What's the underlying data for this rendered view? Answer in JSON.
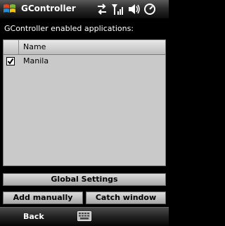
{
  "titlebar": {
    "title": "GController",
    "icons": [
      "windows-start-icon",
      "connectivity-icon",
      "signal-strength-icon",
      "volume-icon",
      "clock-icon"
    ]
  },
  "main": {
    "header_text": "GController enabled applications:",
    "list": {
      "columns": [
        "",
        "Name"
      ],
      "rows": [
        {
          "checked": true,
          "name": "Manila"
        }
      ]
    }
  },
  "buttons": {
    "global_settings": "Global Settings",
    "add_manually": "Add manually",
    "catch_window": "Catch window"
  },
  "softkeys": {
    "left": "Back",
    "center_icon": "keyboard-icon"
  }
}
